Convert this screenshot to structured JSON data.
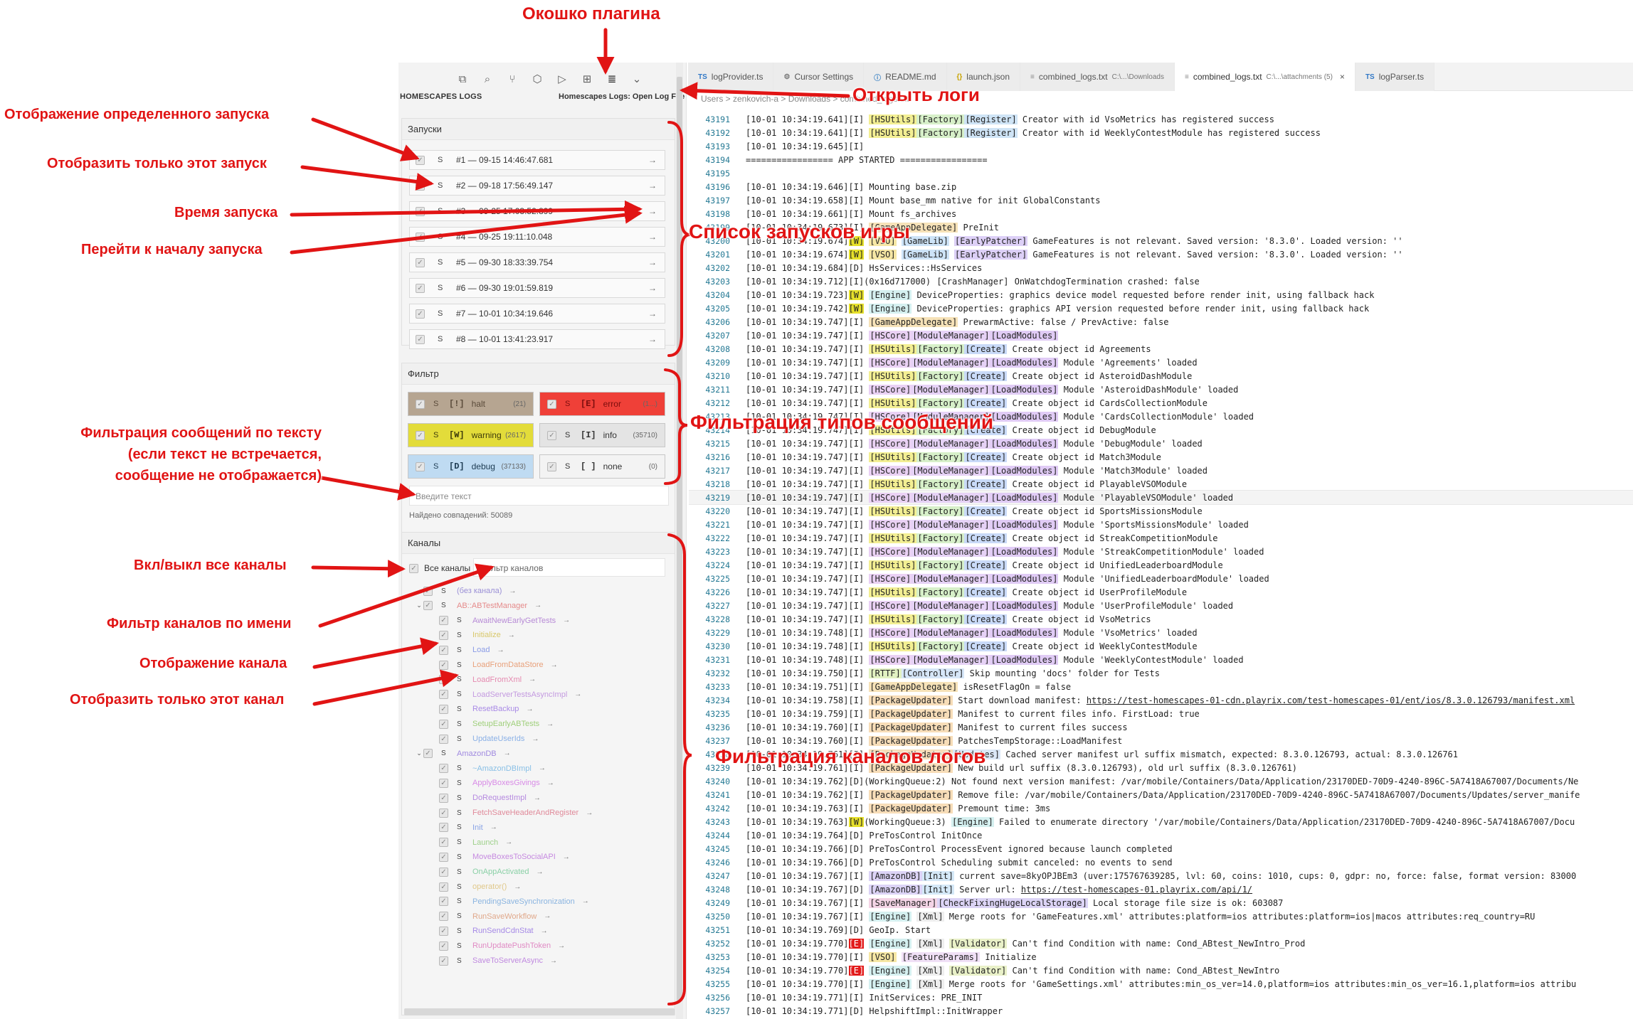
{
  "sidebar": {
    "heading": "HOMESCAPES LOGS",
    "action": "Homescapes Logs: Open Log File",
    "icons": [
      "copy-icon",
      "search-icon",
      "source-control-icon",
      "package-icon",
      "run-debug-icon",
      "extensions-icon",
      "log-list-icon",
      "chevron-down-icon"
    ],
    "runs_title": "Запуски",
    "runs": [
      {
        "label": "#1 — 09-15 14:46:47.681"
      },
      {
        "label": "#2 — 09-18 17:56:49.147"
      },
      {
        "label": "#3 — 09-25 17:03:52.899"
      },
      {
        "label": "#4 — 09-25 19:11:10.048"
      },
      {
        "label": "#5 — 09-30 18:33:39.754"
      },
      {
        "label": "#6 — 09-30 19:01:59.819"
      },
      {
        "label": "#7 — 10-01 10:34:19.646"
      },
      {
        "label": "#8 — 10-01 13:41:23.917"
      }
    ],
    "s_label": "S",
    "go_label": "→",
    "filter_title": "Фильтр",
    "filters": [
      {
        "code": "[!]",
        "name": "halt",
        "count": "(21)",
        "bg": "#b6a591",
        "color": "#5a4b3a"
      },
      {
        "code": "[E]",
        "name": "error",
        "count": "(1...)",
        "bg": "#ef4038",
        "color": "#7a0d0d"
      },
      {
        "code": "[W]",
        "name": "warning",
        "count": "(2617)",
        "bg": "#e3dc3a",
        "color": "#3d3b0b"
      },
      {
        "code": "[I]",
        "name": "info",
        "count": "(35710)",
        "bg": "#e4e4e4",
        "color": "#333333"
      },
      {
        "code": "[D]",
        "name": "debug",
        "count": "(37133)",
        "bg": "#bfdbf2",
        "color": "#1d3b52"
      },
      {
        "code": "[ ]",
        "name": "none",
        "count": "(0)",
        "bg": "#f3f3f3",
        "color": "#333333"
      }
    ],
    "text_filter_placeholder": "Введите текст",
    "matches": "Найдено совпадений: 50089",
    "channels_title": "Каналы",
    "all_channels": "Все каналы",
    "channel_filter_placeholder": "Фильтр каналов",
    "channels": [
      {
        "name": "(без канала)",
        "level": 1,
        "twisty": "",
        "color": "#9a8fd6"
      },
      {
        "name": "AB::ABTestManager",
        "level": 1,
        "twisty": "⌄",
        "color": "#e58a8a"
      },
      {
        "name": "AwaitNewEarlyGetTests",
        "level": 2,
        "twisty": "",
        "color": "#b78ad6"
      },
      {
        "name": "Initialize",
        "level": 2,
        "twisty": "",
        "color": "#d8c86a"
      },
      {
        "name": "Load",
        "level": 2,
        "twisty": "",
        "color": "#8a9be6"
      },
      {
        "name": "LoadFromDataStore",
        "level": 2,
        "twisty": "",
        "color": "#e8a07a"
      },
      {
        "name": "LoadFromXml",
        "level": 2,
        "twisty": "",
        "color": "#e58ab0"
      },
      {
        "name": "LoadServerTestsAsyncImpl",
        "level": 2,
        "twisty": "",
        "color": "#c49ae0"
      },
      {
        "name": "ResetBackup",
        "level": 2,
        "twisty": "",
        "color": "#a98ae6"
      },
      {
        "name": "SetupEarlyABTests",
        "level": 2,
        "twisty": "",
        "color": "#9fcf7a"
      },
      {
        "name": "UpdateUserIds",
        "level": 2,
        "twisty": "",
        "color": "#8ab0e6"
      },
      {
        "name": "AmazonDB",
        "level": 1,
        "twisty": "⌄",
        "color": "#a08ae0"
      },
      {
        "name": "~AmazonDBImpl",
        "level": 2,
        "twisty": "",
        "color": "#8ac0e6"
      },
      {
        "name": "ApplyBoxesGivings",
        "level": 2,
        "twisty": "",
        "color": "#d88ae6"
      },
      {
        "name": "DoRequestImpl",
        "level": 2,
        "twisty": "",
        "color": "#b68ae0"
      },
      {
        "name": "FetchSaveHeaderAndRegister",
        "level": 2,
        "twisty": "",
        "color": "#e08a9a"
      },
      {
        "name": "Init",
        "level": 2,
        "twisty": "",
        "color": "#8aa4e6"
      },
      {
        "name": "Launch",
        "level": 2,
        "twisty": "",
        "color": "#9ed08a"
      },
      {
        "name": "MoveBoxesToSocialAPI",
        "level": 2,
        "twisty": "",
        "color": "#c68ae0"
      },
      {
        "name": "OnAppActivated",
        "level": 2,
        "twisty": "",
        "color": "#8ad0a6"
      },
      {
        "name": "operator()",
        "level": 2,
        "twisty": "",
        "color": "#e0c88a"
      },
      {
        "name": "PendingSaveSynchronization",
        "level": 2,
        "twisty": "",
        "color": "#8ab4e0"
      },
      {
        "name": "RunSaveWorkflow",
        "level": 2,
        "twisty": "",
        "color": "#e0a88a"
      },
      {
        "name": "RunSendCdnStat",
        "level": 2,
        "twisty": "",
        "color": "#a68ae6"
      },
      {
        "name": "RunUpdatePushToken",
        "level": 2,
        "twisty": "",
        "color": "#e08ac4"
      },
      {
        "name": "SaveToServerAsync",
        "level": 2,
        "twisty": "",
        "color": "#c08ae0"
      }
    ]
  },
  "tabs": [
    {
      "icon": "TS",
      "icon_color": "#3178c6",
      "label": "logProvider.ts",
      "sub": "",
      "active": false
    },
    {
      "icon": "⚙",
      "icon_color": "#777777",
      "label": "Cursor Settings",
      "sub": "",
      "active": false
    },
    {
      "icon": "ⓘ",
      "icon_color": "#3b82c4",
      "label": "README.md",
      "sub": "",
      "active": false
    },
    {
      "icon": "{}",
      "icon_color": "#c8a300",
      "label": "launch.json",
      "sub": "",
      "active": false
    },
    {
      "icon": "≡",
      "icon_color": "#888888",
      "label": "combined_logs.txt",
      "sub": "C:\\...\\Downloads",
      "active": false
    },
    {
      "icon": "≡",
      "icon_color": "#888888",
      "label": "combined_logs.txt",
      "sub": "C:\\...\\attachments (5)",
      "active": true
    },
    {
      "icon": "TS",
      "icon_color": "#3178c6",
      "label": "logParser.ts",
      "sub": "",
      "active": false
    }
  ],
  "tab_close": "×",
  "breadcrumb": "Users > zenkovich-a > Downloads > combined_logs.txt",
  "log_lines": [
    {
      "n": "43191",
      "t": "[10-01 10:34:19.641][I] [HSUtils][Factory][Register] Creator with id VsoMetrics has registered success"
    },
    {
      "n": "43192",
      "t": "[10-01 10:34:19.641][I] [HSUtils][Factory][Register] Creator with id WeeklyContestModule has registered success"
    },
    {
      "n": "43193",
      "t": "[10-01 10:34:19.645][I]"
    },
    {
      "n": "43194",
      "t": "================= APP STARTED ================="
    },
    {
      "n": "43195",
      "t": ""
    },
    {
      "n": "43196",
      "t": "[10-01 10:34:19.646][I] Mounting base.zip"
    },
    {
      "n": "43197",
      "t": "[10-01 10:34:19.658][I] Mount base_mm native for init GlobalConstants"
    },
    {
      "n": "43198",
      "t": "[10-01 10:34:19.661][I] Mount fs_archives"
    },
    {
      "n": "43199",
      "t": "[10-01 10:34:19.673][I] [GameAppDelegate] PreInit"
    },
    {
      "n": "43200",
      "t": "[10-01 10:34:19.674][W] [VSO] [GameLib] [EarlyPatcher] GameFeatures is not relevant. Saved version: '8.3.0'. Loaded version: ''"
    },
    {
      "n": "43201",
      "t": "[10-01 10:34:19.674][W] [VSO] [GameLib] [EarlyPatcher] GameFeatures is not relevant. Saved version: '8.3.0'. Loaded version: ''"
    },
    {
      "n": "43202",
      "t": "[10-01 10:34:19.684][D] HsServices::HsServices"
    },
    {
      "n": "43203",
      "t": "[10-01 10:34:19.712][I](0x16d717000) [CrashManager] OnWatchdogTermination crashed: false"
    },
    {
      "n": "43204",
      "t": "[10-01 10:34:19.723][W] [Engine] DeviceProperties: graphics device model requested before render init, using fallback hack"
    },
    {
      "n": "43205",
      "t": "[10-01 10:34:19.742][W] [Engine] DeviceProperties: graphics API version requested before render init, using fallback hack"
    },
    {
      "n": "43206",
      "t": "[10-01 10:34:19.747][I] [GameAppDelegate] PrewarmActive: false / PrevActive: false"
    },
    {
      "n": "43207",
      "t": "[10-01 10:34:19.747][I] [HSCore][ModuleManager][LoadModules]"
    },
    {
      "n": "43208",
      "t": "[10-01 10:34:19.747][I] [HSUtils][Factory][Create] Create object id Agreements"
    },
    {
      "n": "43209",
      "t": "[10-01 10:34:19.747][I] [HSCore][ModuleManager][LoadModules] Module 'Agreements' loaded"
    },
    {
      "n": "43210",
      "t": "[10-01 10:34:19.747][I] [HSUtils][Factory][Create] Create object id AsteroidDashModule"
    },
    {
      "n": "43211",
      "t": "[10-01 10:34:19.747][I] [HSCore][ModuleManager][LoadModules] Module 'AsteroidDashModule' loaded"
    },
    {
      "n": "43212",
      "t": "[10-01 10:34:19.747][I] [HSUtils][Factory][Create] Create object id CardsCollectionModule"
    },
    {
      "n": "43213",
      "t": "[10-01 10:34:19.747][I] [HSCore][ModuleManager][LoadModules] Module 'CardsCollectionModule' loaded"
    },
    {
      "n": "43214",
      "t": "[10-01 10:34:19.747][I] [HSUtils][Factory][Create] Create object id DebugModule"
    },
    {
      "n": "43215",
      "t": "[10-01 10:34:19.747][I] [HSCore][ModuleManager][LoadModules] Module 'DebugModule' loaded"
    },
    {
      "n": "43216",
      "t": "[10-01 10:34:19.747][I] [HSUtils][Factory][Create] Create object id Match3Module"
    },
    {
      "n": "43217",
      "t": "[10-01 10:34:19.747][I] [HSCore][ModuleManager][LoadModules] Module 'Match3Module' loaded"
    },
    {
      "n": "43218",
      "t": "[10-01 10:34:19.747][I] [HSUtils][Factory][Create] Create object id PlayableVSOModule"
    },
    {
      "n": "43219",
      "t": "[10-01 10:34:19.747][I] [HSCore][ModuleManager][LoadModules] Module 'PlayableVSOModule' loaded"
    },
    {
      "n": "43220",
      "t": "[10-01 10:34:19.747][I] [HSUtils][Factory][Create] Create object id SportsMissionsModule"
    },
    {
      "n": "43221",
      "t": "[10-01 10:34:19.747][I] [HSCore][ModuleManager][LoadModules] Module 'SportsMissionsModule' loaded"
    },
    {
      "n": "43222",
      "t": "[10-01 10:34:19.747][I] [HSUtils][Factory][Create] Create object id StreakCompetitionModule"
    },
    {
      "n": "43223",
      "t": "[10-01 10:34:19.747][I] [HSCore][ModuleManager][LoadModules] Module 'StreakCompetitionModule' loaded"
    },
    {
      "n": "43224",
      "t": "[10-01 10:34:19.747][I] [HSUtils][Factory][Create] Create object id UnifiedLeaderboardModule"
    },
    {
      "n": "43225",
      "t": "[10-01 10:34:19.747][I] [HSCore][ModuleManager][LoadModules] Module 'UnifiedLeaderboardModule' loaded"
    },
    {
      "n": "43226",
      "t": "[10-01 10:34:19.747][I] [HSUtils][Factory][Create] Create object id UserProfileModule"
    },
    {
      "n": "43227",
      "t": "[10-01 10:34:19.747][I] [HSCore][ModuleManager][LoadModules] Module 'UserProfileModule' loaded"
    },
    {
      "n": "43228",
      "t": "[10-01 10:34:19.747][I] [HSUtils][Factory][Create] Create object id VsoMetrics"
    },
    {
      "n": "43229",
      "t": "[10-01 10:34:19.748][I] [HSCore][ModuleManager][LoadModules] Module 'VsoMetrics' loaded"
    },
    {
      "n": "43230",
      "t": "[10-01 10:34:19.748][I] [HSUtils][Factory][Create] Create object id WeeklyContestModule"
    },
    {
      "n": "43231",
      "t": "[10-01 10:34:19.748][I] [HSCore][ModuleManager][LoadModules] Module 'WeeklyContestModule' loaded"
    },
    {
      "n": "43232",
      "t": "[10-01 10:34:19.750][I] [RTTF][Controller] Skip mounting 'docs' folder for Tests"
    },
    {
      "n": "43233",
      "t": "[10-01 10:34:19.751][I] [GameAppDelegate] isResetFlagOn = false"
    },
    {
      "n": "43234",
      "t": "[10-01 10:34:19.758][I] [PackageUpdater] Start download manifest: https://test-homescapes-01-cdn.playrix.com/test-homescapes-01/ent/ios/8.3.0.126793/manifest.xml"
    },
    {
      "n": "43235",
      "t": "[10-01 10:34:19.759][I] [PackageUpdater] Manifest to current files info. FirstLoad: true"
    },
    {
      "n": "43236",
      "t": "[10-01 10:34:19.760][I] [PackageUpdater] Manifest to current files success"
    },
    {
      "n": "43237",
      "t": "[10-01 10:34:19.760][I] [PackageUpdater] PatchesTempStorage::LoadManifest"
    },
    {
      "n": "43238",
      "t": "[10-01 10:34:19.761][I] [PackageUpdater][Updates] Cached server manifest url suffix mismatch, expected: 8.3.0.126793, actual: 8.3.0.126761"
    },
    {
      "n": "43239",
      "t": "[10-01 10:34:19.761][I] [PackageUpdater] New build url suffix (8.3.0.126793), old url suffix (8.3.0.126761)"
    },
    {
      "n": "43240",
      "t": "[10-01 10:34:19.762][D](WorkingQueue:2) Not found next version manifest: /var/mobile/Containers/Data/Application/23170DED-70D9-4240-896C-5A7418A67007/Documents/Ne"
    },
    {
      "n": "43241",
      "t": "[10-01 10:34:19.762][I] [PackageUpdater] Remove file: /var/mobile/Containers/Data/Application/23170DED-70D9-4240-896C-5A7418A67007/Documents/Updates/server_manife"
    },
    {
      "n": "43242",
      "t": "[10-01 10:34:19.763][I] [PackageUpdater] Premount time: 3ms"
    },
    {
      "n": "43243",
      "t": "[10-01 10:34:19.763][W](WorkingQueue:3) [Engine] Failed to enumerate directory '/var/mobile/Containers/Data/Application/23170DED-70D9-4240-896C-5A7418A67007/Docu"
    },
    {
      "n": "43244",
      "t": "[10-01 10:34:19.764][D] PreTosControl InitOnce"
    },
    {
      "n": "43245",
      "t": "[10-01 10:34:19.766][D] PreTosControl ProcessEvent ignored because launch completed"
    },
    {
      "n": "43246",
      "t": "[10-01 10:34:19.766][D] PreTosControl Scheduling submit canceled: no events to send"
    },
    {
      "n": "43247",
      "t": "[10-01 10:34:19.767][I] [AmazonDB][Init] current save=8kyOPJBEm3 (uver:175767639285, lvl: 60, coins: 1010, cups: 0, gdpr: no, force: false, format version: 83000"
    },
    {
      "n": "43248",
      "t": "[10-01 10:34:19.767][D] [AmazonDB][Init] Server url: https://test-homescapes-01.playrix.com/api/1/"
    },
    {
      "n": "43249",
      "t": "[10-01 10:34:19.767][I] [SaveManager][CheckFixingHugeLocalStorage] Local storage file size is ok: 603087"
    },
    {
      "n": "43250",
      "t": "[10-01 10:34:19.767][I] [Engine] [Xml] Merge roots for 'GameFeatures.xml' attributes:platform=ios attributes:platform=ios|macos attributes:req_country=RU"
    },
    {
      "n": "43251",
      "t": "[10-01 10:34:19.769][D] GeoIp. Start"
    },
    {
      "n": "43252",
      "t": "[10-01 10:34:19.770][E] [Engine] [Xml] [Validator] Can't find Condition with name: Cond_ABtest_NewIntro_Prod"
    },
    {
      "n": "43253",
      "t": "[10-01 10:34:19.770][I] [VSO] [FeatureParams] Initialize"
    },
    {
      "n": "43254",
      "t": "[10-01 10:34:19.770][E] [Engine] [Xml] [Validator] Can't find Condition with name: Cond_ABtest_NewIntro"
    },
    {
      "n": "43255",
      "t": "[10-01 10:34:19.770][I] [Engine] [Xml] Merge roots for 'GameSettings.xml' attributes:min_os_ver=14.0,platform=ios attributes:min_os_ver=16.1,platform=ios attribu"
    },
    {
      "n": "43256",
      "t": "[10-01 10:34:19.771][I] InitServices: PRE_INIT"
    },
    {
      "n": "43257",
      "t": "[10-01 10:34:19.771][D] HelpshiftImpl::InitWrapper"
    }
  ],
  "annotations": {
    "plugin_window": "Окошко плагина",
    "open_logs": "Открыть логи",
    "show_specific_run": "Отображение определенного запуска",
    "show_only_this_run": "Отобразить только этот запуск",
    "run_time": "Время запуска",
    "go_to_run_start": "Перейти к началу запуска",
    "runs_list": "Список запусков игры",
    "text_filter_1": "Фильтрация сообщений по тексту",
    "text_filter_2": "(если текст не встречается,",
    "text_filter_3": "сообщение не отображается)",
    "type_filter": "Фильтрация типов сообщений",
    "toggle_all_channels": "Вкл/выкл все каналы",
    "channel_name_filter": "Фильтр каналов по имени",
    "channel_display": "Отображение канала",
    "show_only_this_channel": "Отобразить только этот канал",
    "channel_filter": "Фильтрация каналов логов"
  },
  "colors": {
    "annotation": "#e11414",
    "line_number": "#237893"
  }
}
